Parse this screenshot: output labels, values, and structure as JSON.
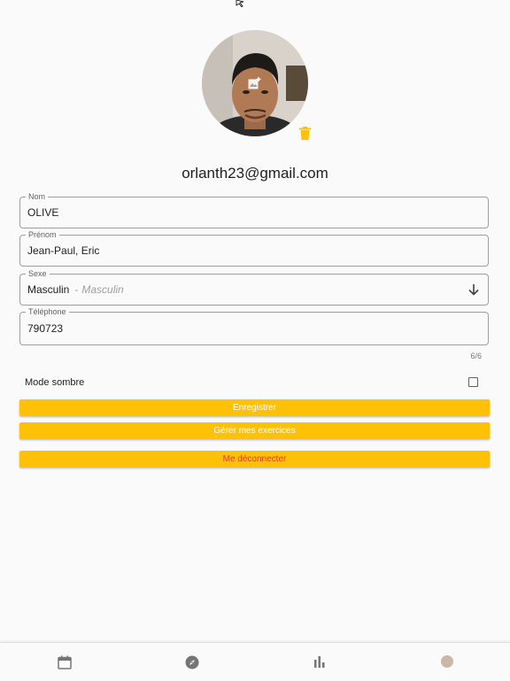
{
  "profile": {
    "email": "orlanth23@gmail.com"
  },
  "form": {
    "nom": {
      "label": "Nom",
      "value": "OLIVE"
    },
    "prenom": {
      "label": "Prénom",
      "value": "Jean-Paul, Eric"
    },
    "sexe": {
      "label": "Sexe",
      "value": "Masculin",
      "separator": "-",
      "hint": "Masculin"
    },
    "telephone": {
      "label": "Téléphone",
      "value": "790723",
      "counter": "6/6"
    }
  },
  "settings": {
    "dark_mode_label": "Mode sombre",
    "dark_mode_checked": false
  },
  "buttons": {
    "save": "Enregistrer",
    "exercises": "Gérer mes exercices",
    "logout": "Me déconnecter"
  },
  "bottom_nav": {
    "items": [
      {
        "icon": "calendar-icon"
      },
      {
        "icon": "compass-icon"
      },
      {
        "icon": "bar-chart-icon"
      },
      {
        "icon": "profile-avatar-icon"
      }
    ]
  },
  "colors": {
    "accent": "#ffc107",
    "logout_text": "#e53935",
    "background": "#fafafa"
  }
}
